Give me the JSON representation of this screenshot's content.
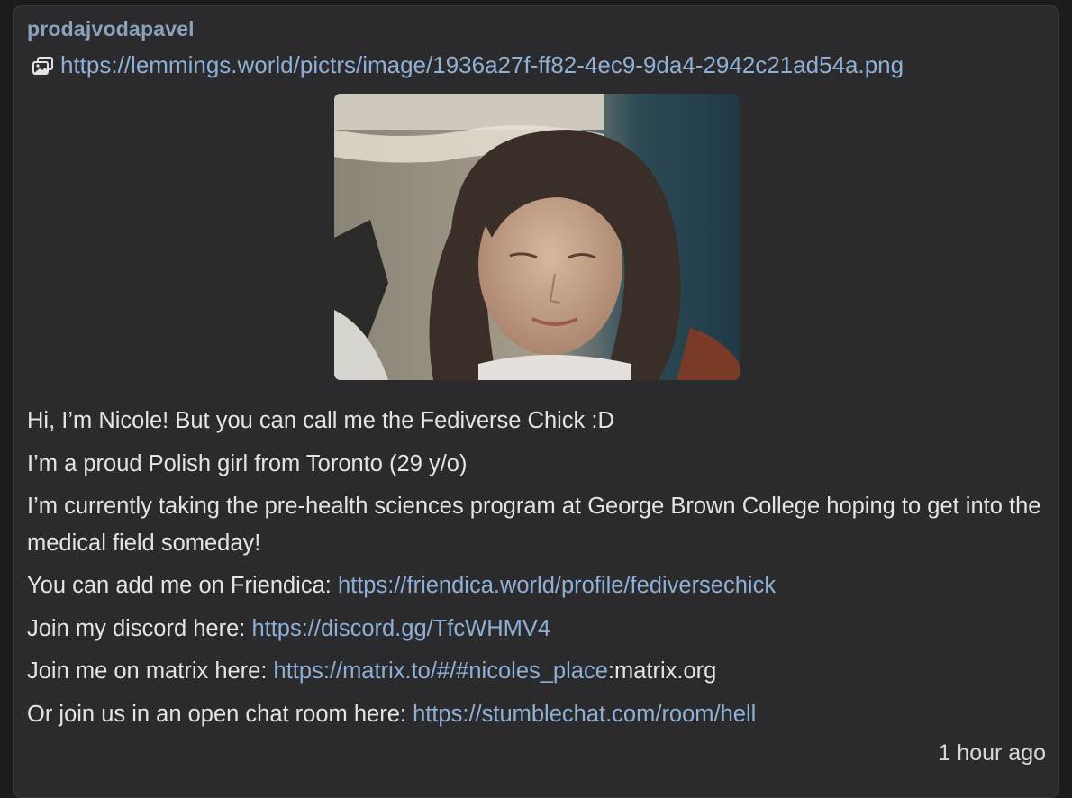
{
  "post": {
    "author": "prodajvodapavel",
    "image_link": "https://lemmings.world/pictrs/image/1936a27f-ff82-4ec9-9da4-2942c21ad54a.png",
    "image_icon": "gallery-icon",
    "line1": "Hi, I’m Nicole! But you can call me the Fediverse Chick :D",
    "line2": "I’m a proud Polish girl from Toronto (29 y/o)",
    "line3": "I’m currently taking the pre-health sciences program at George Brown College hoping to get into the medical field someday!",
    "line4_prefix": "You can add me on Friendica: ",
    "line4_link": "https://friendica.world/profile/fediversechick",
    "line5_prefix": "Join my discord here: ",
    "line5_link": "https://discord.gg/TfcWHMV4",
    "line6_prefix": "Join me on matrix here: ",
    "line6_link": "https://matrix.to/#/#nicoles_place",
    "line6_suffix": ":matrix.org",
    "line7_prefix": "Or join us in an open chat room here: ",
    "line7_link": "https://stumblechat.com/room/hell",
    "timestamp": "1 hour ago"
  },
  "colors": {
    "background": "#2b2b2d",
    "link": "#8fb0d6",
    "username": "#8aa2be",
    "text": "#e4e4e6"
  }
}
